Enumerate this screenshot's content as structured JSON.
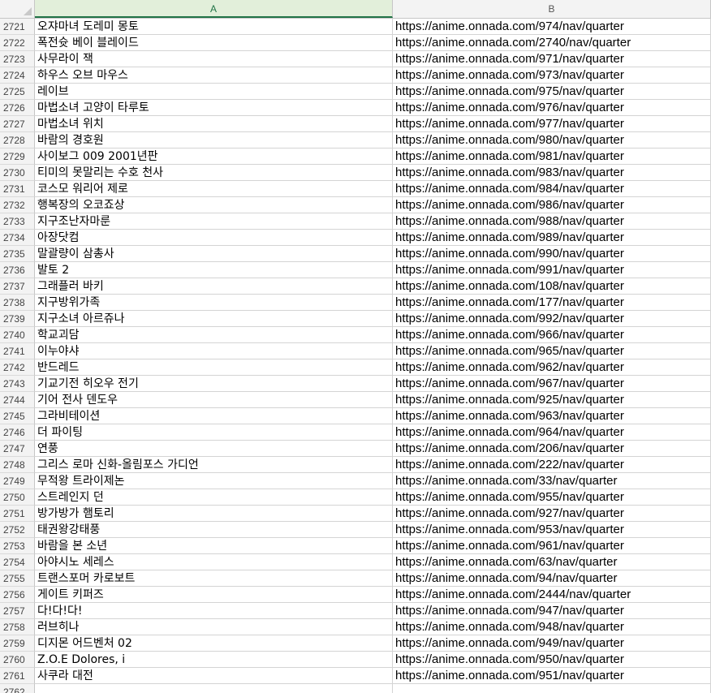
{
  "columns": {
    "a_label": "A",
    "b_label": "B"
  },
  "rows": [
    {
      "num": "2721",
      "a": "오쟈마녀 도레미 몽토",
      "b": "https://anime.onnada.com/974/nav/quarter"
    },
    {
      "num": "2722",
      "a": "폭전슛 베이 블레이드",
      "b": "https://anime.onnada.com/2740/nav/quarter"
    },
    {
      "num": "2723",
      "a": "사무라이 잭",
      "b": "https://anime.onnada.com/971/nav/quarter"
    },
    {
      "num": "2724",
      "a": "하우스 오브 마우스",
      "b": "https://anime.onnada.com/973/nav/quarter"
    },
    {
      "num": "2725",
      "a": "레이브",
      "b": "https://anime.onnada.com/975/nav/quarter"
    },
    {
      "num": "2726",
      "a": "마법소녀 고양이 타루토",
      "b": "https://anime.onnada.com/976/nav/quarter"
    },
    {
      "num": "2727",
      "a": "마법소녀 위치",
      "b": "https://anime.onnada.com/977/nav/quarter"
    },
    {
      "num": "2728",
      "a": "바람의 경호원",
      "b": "https://anime.onnada.com/980/nav/quarter"
    },
    {
      "num": "2729",
      "a": "사이보그 009 2001년판",
      "b": "https://anime.onnada.com/981/nav/quarter"
    },
    {
      "num": "2730",
      "a": "티미의 못말리는 수호 천사",
      "b": "https://anime.onnada.com/983/nav/quarter"
    },
    {
      "num": "2731",
      "a": "코스모 워리어 제로",
      "b": "https://anime.onnada.com/984/nav/quarter"
    },
    {
      "num": "2732",
      "a": "행복장의 오코죠상",
      "b": "https://anime.onnada.com/986/nav/quarter"
    },
    {
      "num": "2733",
      "a": "지구조난자마룬",
      "b": "https://anime.onnada.com/988/nav/quarter"
    },
    {
      "num": "2734",
      "a": "아장닷컴",
      "b": "https://anime.onnada.com/989/nav/quarter"
    },
    {
      "num": "2735",
      "a": "말괄량이 삼총사",
      "b": "https://anime.onnada.com/990/nav/quarter"
    },
    {
      "num": "2736",
      "a": "발토 2",
      "b": "https://anime.onnada.com/991/nav/quarter"
    },
    {
      "num": "2737",
      "a": "그래플러 바키",
      "b": "https://anime.onnada.com/108/nav/quarter"
    },
    {
      "num": "2738",
      "a": "지구방위가족",
      "b": "https://anime.onnada.com/177/nav/quarter"
    },
    {
      "num": "2739",
      "a": "지구소녀 아르쥬나",
      "b": "https://anime.onnada.com/992/nav/quarter"
    },
    {
      "num": "2740",
      "a": "학교괴담",
      "b": "https://anime.onnada.com/966/nav/quarter"
    },
    {
      "num": "2741",
      "a": "이누야샤",
      "b": "https://anime.onnada.com/965/nav/quarter"
    },
    {
      "num": "2742",
      "a": "반드레드",
      "b": "https://anime.onnada.com/962/nav/quarter"
    },
    {
      "num": "2743",
      "a": "기교기전 히오우 전기",
      "b": "https://anime.onnada.com/967/nav/quarter"
    },
    {
      "num": "2744",
      "a": "기어 전사 덴도우",
      "b": "https://anime.onnada.com/925/nav/quarter"
    },
    {
      "num": "2745",
      "a": "그라비테이션",
      "b": "https://anime.onnada.com/963/nav/quarter"
    },
    {
      "num": "2746",
      "a": "더 파이팅",
      "b": "https://anime.onnada.com/964/nav/quarter"
    },
    {
      "num": "2747",
      "a": "연풍",
      "b": "https://anime.onnada.com/206/nav/quarter"
    },
    {
      "num": "2748",
      "a": "그리스 로마 신화-올림포스 가디언",
      "b": "https://anime.onnada.com/222/nav/quarter"
    },
    {
      "num": "2749",
      "a": "무적왕 트라이제논",
      "b": "https://anime.onnada.com/33/nav/quarter"
    },
    {
      "num": "2750",
      "a": "스트레인지 던",
      "b": "https://anime.onnada.com/955/nav/quarter"
    },
    {
      "num": "2751",
      "a": "방가방가 햄토리",
      "b": "https://anime.onnada.com/927/nav/quarter"
    },
    {
      "num": "2752",
      "a": "태권왕강태풍",
      "b": "https://anime.onnada.com/953/nav/quarter"
    },
    {
      "num": "2753",
      "a": "바람을 본 소년",
      "b": "https://anime.onnada.com/961/nav/quarter"
    },
    {
      "num": "2754",
      "a": "아야시노 세레스",
      "b": "https://anime.onnada.com/63/nav/quarter"
    },
    {
      "num": "2755",
      "a": "트랜스포머 카로보트",
      "b": "https://anime.onnada.com/94/nav/quarter"
    },
    {
      "num": "2756",
      "a": "게이트 키퍼즈",
      "b": "https://anime.onnada.com/2444/nav/quarter"
    },
    {
      "num": "2757",
      "a": "다!다!다!",
      "b": "https://anime.onnada.com/947/nav/quarter"
    },
    {
      "num": "2758",
      "a": "러브히나",
      "b": "https://anime.onnada.com/948/nav/quarter"
    },
    {
      "num": "2759",
      "a": "디지몬 어드벤처 02",
      "b": "https://anime.onnada.com/949/nav/quarter"
    },
    {
      "num": "2760",
      "a": "Z.O.E Dolores, i",
      "b": "https://anime.onnada.com/950/nav/quarter"
    },
    {
      "num": "2761",
      "a": "사쿠라 대전",
      "b": "https://anime.onnada.com/951/nav/quarter"
    },
    {
      "num": "2762",
      "a": "",
      "b": ""
    }
  ]
}
